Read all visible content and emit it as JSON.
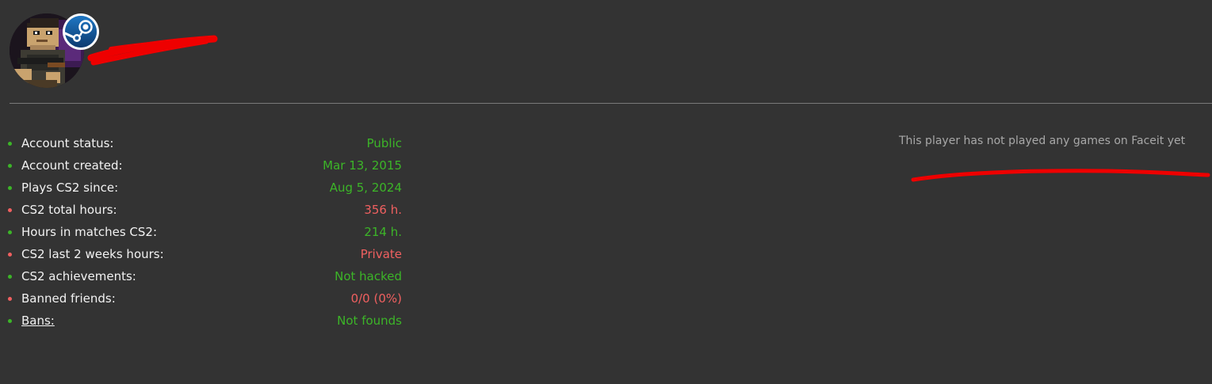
{
  "colors": {
    "background": "#333333",
    "good": "#3cb528",
    "bad": "#f06060",
    "label": "#f2f2f2",
    "muted": "#a8a8a8",
    "redaction": "#ee0000"
  },
  "profile": {
    "avatar": "pixel-character-avatar",
    "badge_icon": "steam-icon",
    "name_redacted": true
  },
  "stats": [
    {
      "label": "Account status:",
      "value": "Public",
      "status": "good"
    },
    {
      "label": "Account created:",
      "value": "Mar 13, 2015",
      "status": "good"
    },
    {
      "label": "Plays CS2 since:",
      "value": "Aug 5, 2024",
      "status": "good"
    },
    {
      "label": "CS2 total hours:",
      "value": "356 h.",
      "status": "bad"
    },
    {
      "label": "Hours in matches CS2:",
      "value": "214 h.",
      "status": "good"
    },
    {
      "label": "CS2 last 2 weeks hours:",
      "value": "Private",
      "status": "bad"
    },
    {
      "label": "CS2 achievements:",
      "value": "Not hacked",
      "status": "good"
    },
    {
      "label": "Banned friends:",
      "value": "0/0 (0%)",
      "status": "bad"
    },
    {
      "label": "Bans:",
      "value": "Not founds",
      "status": "good",
      "link": true
    }
  ],
  "faceit": {
    "message": "This player has not played any games on Faceit yet"
  }
}
